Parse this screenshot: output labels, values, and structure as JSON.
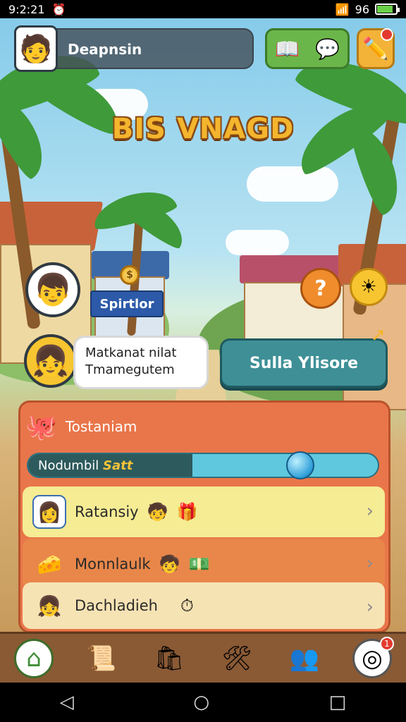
{
  "status_bar": {
    "time": "9:2:21",
    "notif_icon": "alarm-icon",
    "signal": "96"
  },
  "header": {
    "player_name": "Deapnsin",
    "avatar_icon": "player-avatar-icon",
    "green_button_icons": [
      "book-icon",
      "chat-icon"
    ],
    "yellow_button_icon": "edit-pencil-icon"
  },
  "game_title": "BIS VNAGD",
  "scene": {
    "sign_label": "Spirtlor",
    "speech_line1": "Matkanat nilat",
    "speech_line2": "Tmamegutem",
    "question_badge": "?",
    "cta_label": "Sulla Ylisore"
  },
  "quest_panel": {
    "title": "Tostaniam",
    "progress_label_plain": "Nodumbil",
    "progress_label_highlight": "Satt",
    "progress_value": 0.47,
    "rows": [
      {
        "label": "Ratansiy",
        "bg": "#f5ec94",
        "icon": "girl-portrait-icon"
      },
      {
        "label": "Monnlaulk",
        "bg": "#e9874a",
        "icon": "cheese-icon"
      },
      {
        "label": "Dachladieh",
        "bg": "#f6e3b4",
        "icon": "girl-face-icon"
      }
    ]
  },
  "bottom_nav": [
    {
      "name": "home",
      "icon": "home-icon"
    },
    {
      "name": "quests",
      "icon": "scroll-icon"
    },
    {
      "name": "shop",
      "icon": "bag-icon"
    },
    {
      "name": "tools",
      "icon": "tools-icon"
    },
    {
      "name": "friends",
      "icon": "friends-icon"
    },
    {
      "name": "profile",
      "icon": "settings-icon",
      "badge": "1"
    }
  ],
  "colors": {
    "panel": "#e9764a",
    "cta": "#3e8f96",
    "title": "#f4b52e"
  }
}
